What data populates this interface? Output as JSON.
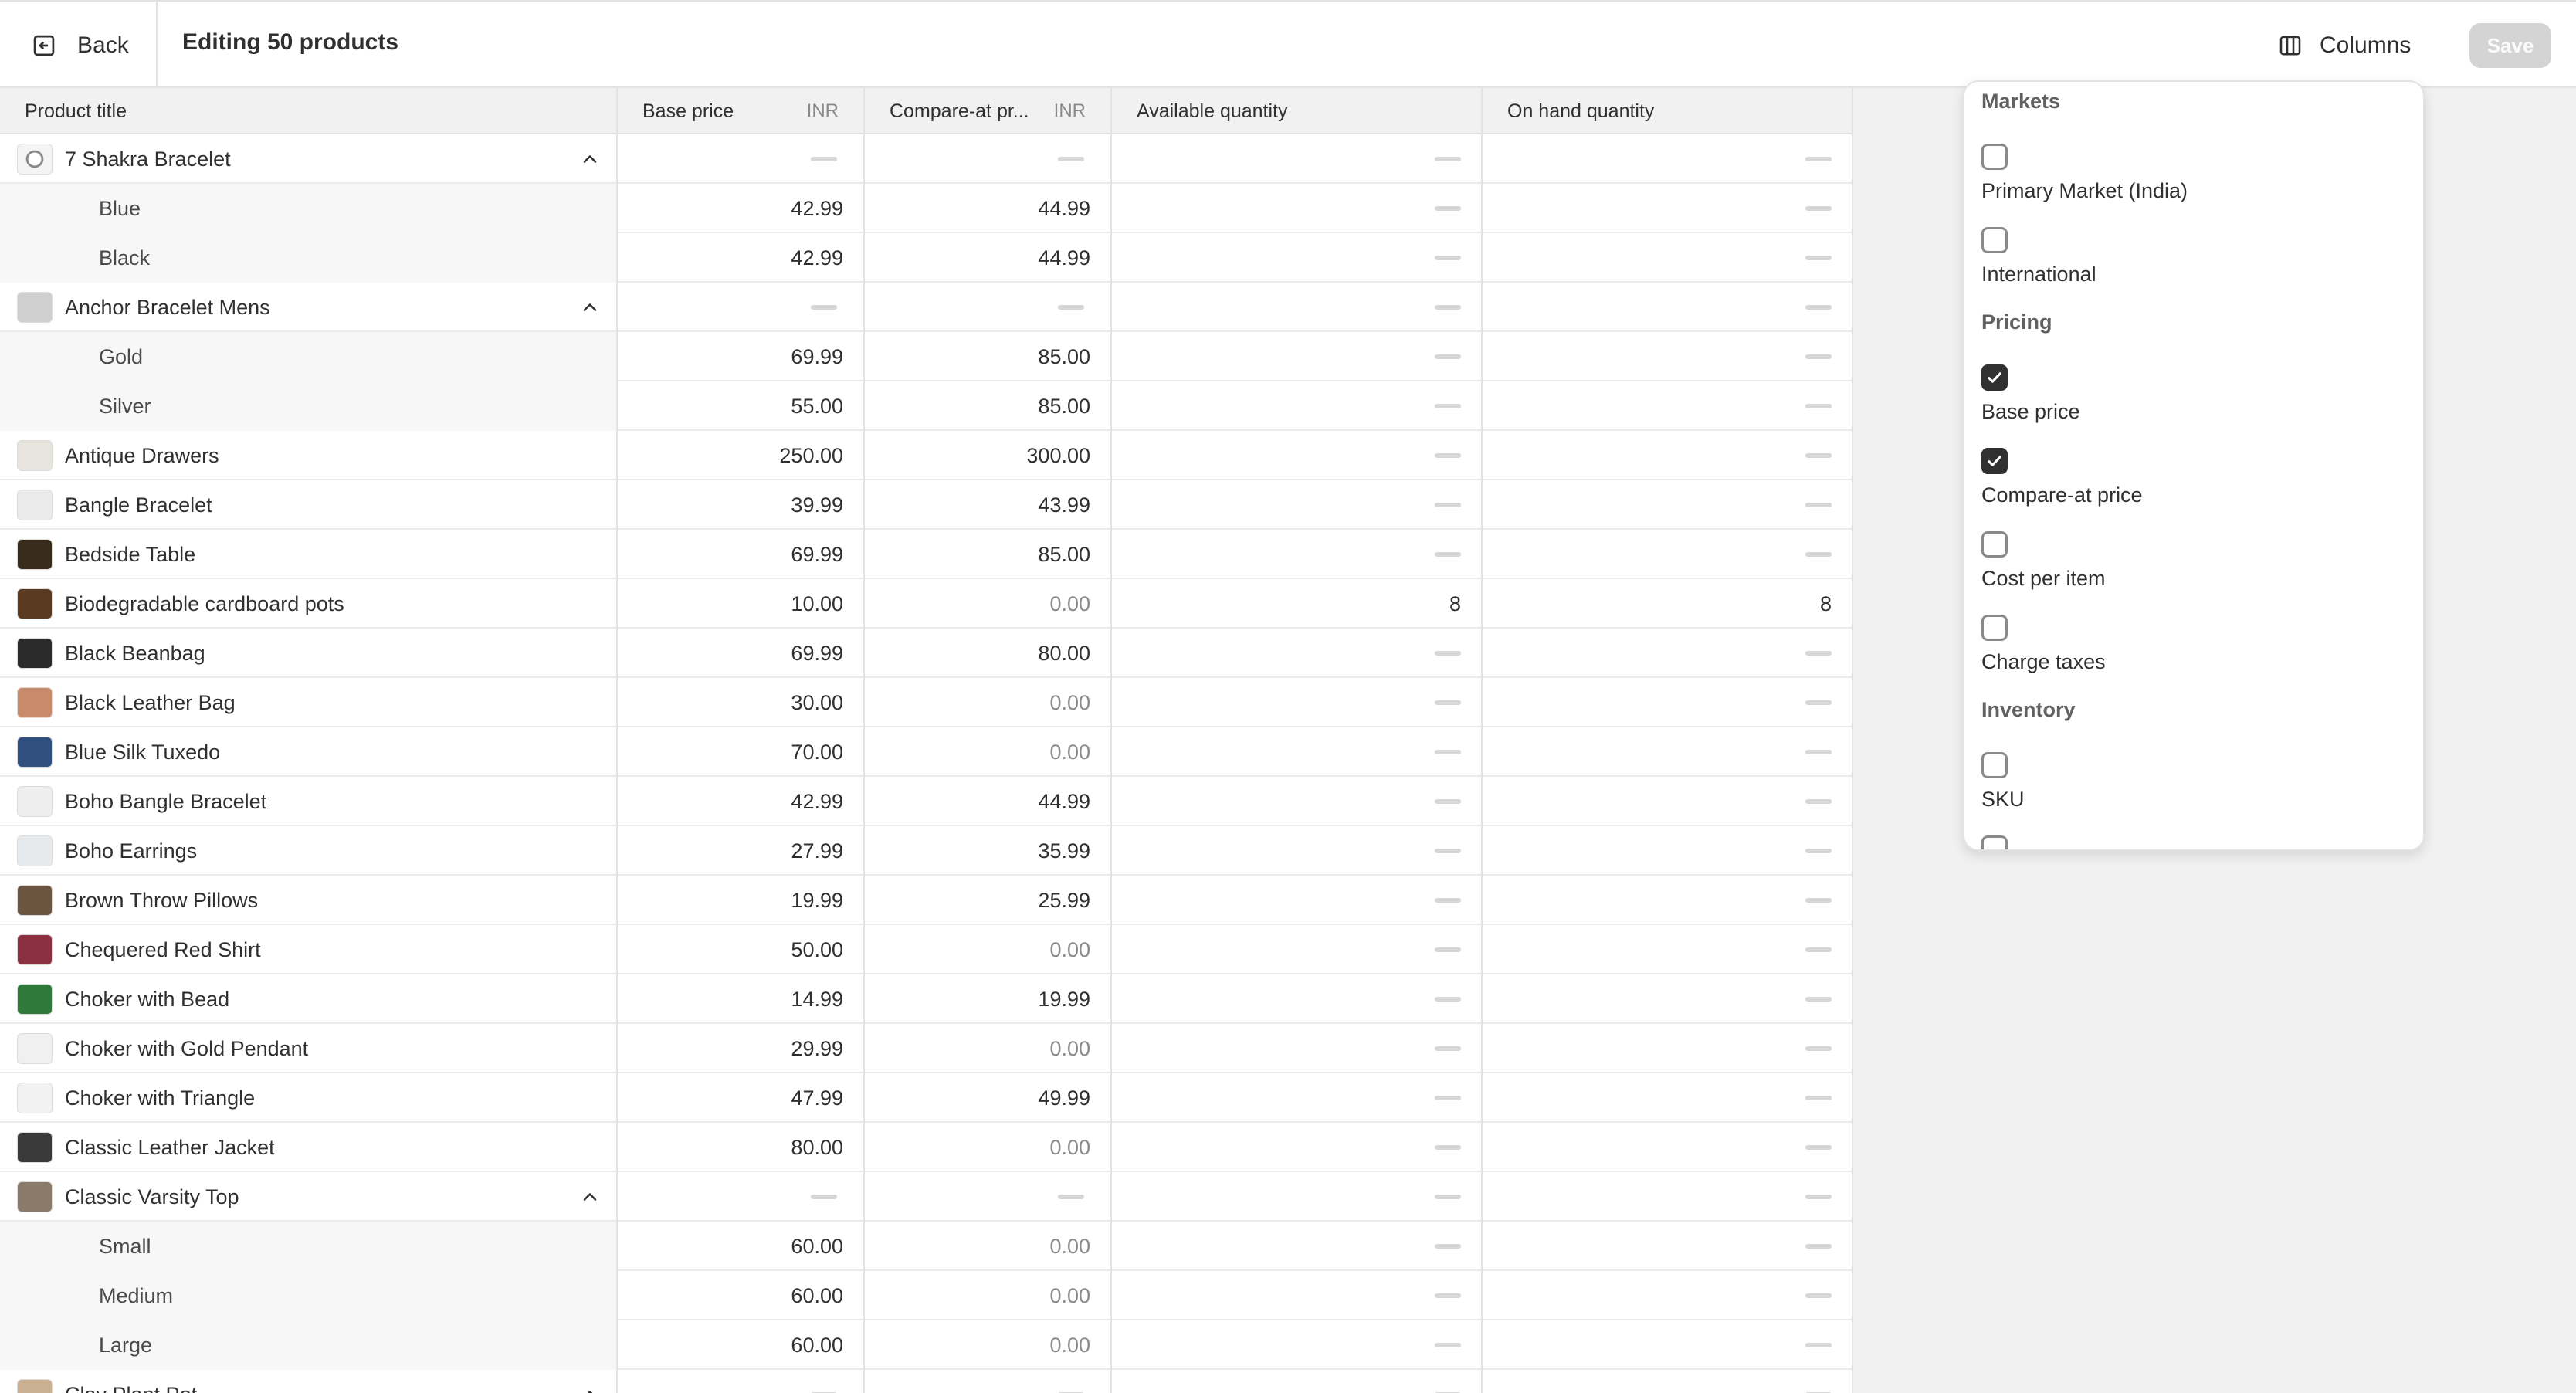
{
  "header": {
    "back_label": "Back",
    "title": "Editing 50 products",
    "columns_label": "Columns",
    "save_label": "Save"
  },
  "grid": {
    "columns": [
      {
        "key": "title",
        "label": "Product title",
        "unit": ""
      },
      {
        "key": "base",
        "label": "Base price",
        "unit": "INR"
      },
      {
        "key": "compare",
        "label": "Compare-at pr...",
        "unit": "INR"
      },
      {
        "key": "avail",
        "label": "Available quantity",
        "unit": ""
      },
      {
        "key": "onhand",
        "label": "On hand quantity",
        "unit": ""
      }
    ],
    "rows": [
      {
        "type": "parent",
        "title": "7 Shakra Bracelet",
        "thumb": "ring",
        "base": null,
        "compare": null,
        "avail": null,
        "onhand": null,
        "expanded": true
      },
      {
        "type": "variant",
        "title": "Blue",
        "base": "42.99",
        "compare": "44.99",
        "avail": null,
        "onhand": null
      },
      {
        "type": "variant",
        "title": "Black",
        "base": "42.99",
        "compare": "44.99",
        "avail": null,
        "onhand": null
      },
      {
        "type": "parent",
        "title": "Anchor Bracelet Mens",
        "thumb": "#cfcfcf",
        "base": null,
        "compare": null,
        "avail": null,
        "onhand": null,
        "expanded": true
      },
      {
        "type": "variant",
        "title": "Gold",
        "base": "69.99",
        "compare": "85.00",
        "avail": null,
        "onhand": null
      },
      {
        "type": "variant",
        "title": "Silver",
        "base": "55.00",
        "compare": "85.00",
        "avail": null,
        "onhand": null
      },
      {
        "type": "product",
        "title": "Antique Drawers",
        "thumb": "#e8e4de",
        "base": "250.00",
        "compare": "300.00",
        "avail": null,
        "onhand": null
      },
      {
        "type": "product",
        "title": "Bangle Bracelet",
        "thumb": "#ebebeb",
        "base": "39.99",
        "compare": "43.99",
        "avail": null,
        "onhand": null
      },
      {
        "type": "product",
        "title": "Bedside Table",
        "thumb": "#3a2c1c",
        "base": "69.99",
        "compare": "85.00",
        "avail": null,
        "onhand": null
      },
      {
        "type": "product",
        "title": "Biodegradable cardboard pots",
        "thumb": "#5a3a20",
        "base": "10.00",
        "compare": "0.00",
        "compare_muted": true,
        "avail": "8",
        "onhand": "8"
      },
      {
        "type": "product",
        "title": "Black Beanbag",
        "thumb": "#2b2b2b",
        "base": "69.99",
        "compare": "80.00",
        "avail": null,
        "onhand": null
      },
      {
        "type": "product",
        "title": "Black Leather Bag",
        "thumb": "#c88a6a",
        "base": "30.00",
        "compare": "0.00",
        "compare_muted": true,
        "avail": null,
        "onhand": null
      },
      {
        "type": "product",
        "title": "Blue Silk Tuxedo",
        "thumb": "#2f4f7f",
        "base": "70.00",
        "compare": "0.00",
        "compare_muted": true,
        "avail": null,
        "onhand": null
      },
      {
        "type": "product",
        "title": "Boho Bangle Bracelet",
        "thumb": "#eeeeee",
        "base": "42.99",
        "compare": "44.99",
        "avail": null,
        "onhand": null
      },
      {
        "type": "product",
        "title": "Boho Earrings",
        "thumb": "#e6eaec",
        "base": "27.99",
        "compare": "35.99",
        "avail": null,
        "onhand": null
      },
      {
        "type": "product",
        "title": "Brown Throw Pillows",
        "thumb": "#6b5540",
        "base": "19.99",
        "compare": "25.99",
        "avail": null,
        "onhand": null
      },
      {
        "type": "product",
        "title": "Chequered Red Shirt",
        "thumb": "#8a3040",
        "base": "50.00",
        "compare": "0.00",
        "compare_muted": true,
        "avail": null,
        "onhand": null
      },
      {
        "type": "product",
        "title": "Choker with Bead",
        "thumb": "#2f7a3a",
        "base": "14.99",
        "compare": "19.99",
        "avail": null,
        "onhand": null
      },
      {
        "type": "product",
        "title": "Choker with Gold Pendant",
        "thumb": "#f0f0f0",
        "base": "29.99",
        "compare": "0.00",
        "compare_muted": true,
        "avail": null,
        "onhand": null
      },
      {
        "type": "product",
        "title": "Choker with Triangle",
        "thumb": "#f2f2f2",
        "base": "47.99",
        "compare": "49.99",
        "avail": null,
        "onhand": null
      },
      {
        "type": "product",
        "title": "Classic Leather Jacket",
        "thumb": "#3a3a3a",
        "base": "80.00",
        "compare": "0.00",
        "compare_muted": true,
        "avail": null,
        "onhand": null
      },
      {
        "type": "parent",
        "title": "Classic Varsity Top",
        "thumb": "#8a7a6a",
        "base": null,
        "compare": null,
        "avail": null,
        "onhand": null,
        "expanded": true
      },
      {
        "type": "variant",
        "title": "Small",
        "base": "60.00",
        "compare": "0.00",
        "compare_muted": true,
        "avail": null,
        "onhand": null
      },
      {
        "type": "variant",
        "title": "Medium",
        "base": "60.00",
        "compare": "0.00",
        "compare_muted": true,
        "avail": null,
        "onhand": null
      },
      {
        "type": "variant",
        "title": "Large",
        "base": "60.00",
        "compare": "0.00",
        "compare_muted": true,
        "avail": null,
        "onhand": null
      },
      {
        "type": "parent",
        "title": "Clay Plant Pot",
        "thumb": "#c8b090",
        "base": null,
        "compare": null,
        "avail": null,
        "onhand": null,
        "expanded": true
      }
    ]
  },
  "columns_popover": {
    "sections": [
      {
        "label": "Markets",
        "options": [
          {
            "label": "Primary Market (India)",
            "checked": false
          },
          {
            "label": "International",
            "checked": false
          }
        ]
      },
      {
        "label": "Pricing",
        "options": [
          {
            "label": "Base price",
            "checked": true
          },
          {
            "label": "Compare-at price",
            "checked": true
          },
          {
            "label": "Cost per item",
            "checked": false
          },
          {
            "label": "Charge taxes",
            "checked": false
          }
        ]
      },
      {
        "label": "Inventory",
        "options": [
          {
            "label": "SKU",
            "checked": false
          }
        ]
      }
    ]
  }
}
